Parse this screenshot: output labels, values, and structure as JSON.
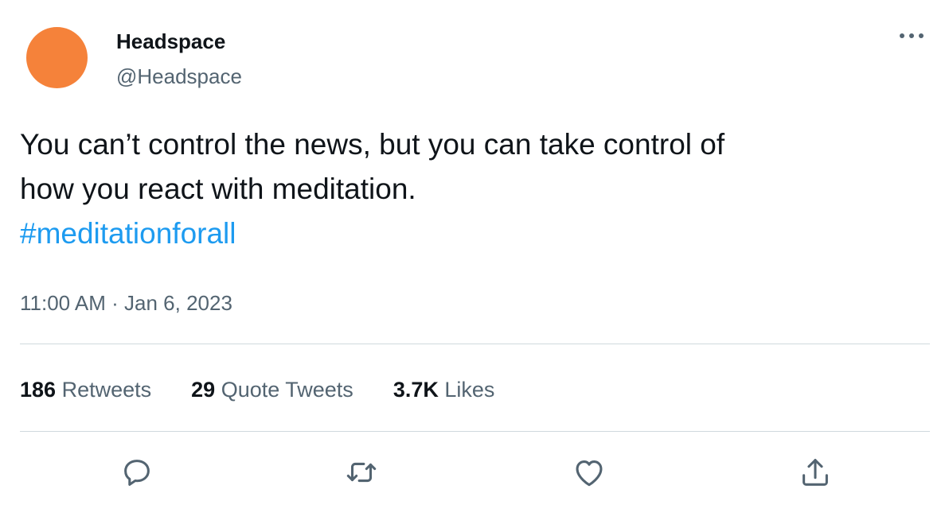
{
  "tweet": {
    "author": {
      "display_name": "Headspace",
      "handle": "@Headspace",
      "avatar_color": "#f5823a"
    },
    "text_lines": [
      "You can’t control the news, but you can take control of",
      "how you react with meditation."
    ],
    "hashtag": "#meditationforall",
    "timestamp": "11:00 AM · Jan 6, 2023",
    "stats": {
      "retweets_count": "186",
      "retweets_label": "Retweets",
      "quotes_count": "29",
      "quotes_label": "Quote Tweets",
      "likes_count": "3.7K",
      "likes_label": "Likes"
    },
    "actions": [
      "reply-icon",
      "retweet-icon",
      "like-icon",
      "share-icon"
    ],
    "colors": {
      "link": "#1d9bf0",
      "secondary_text": "#536471",
      "primary_text": "#0f1419",
      "divider": "#cfd9de",
      "icon": "#536471"
    }
  }
}
